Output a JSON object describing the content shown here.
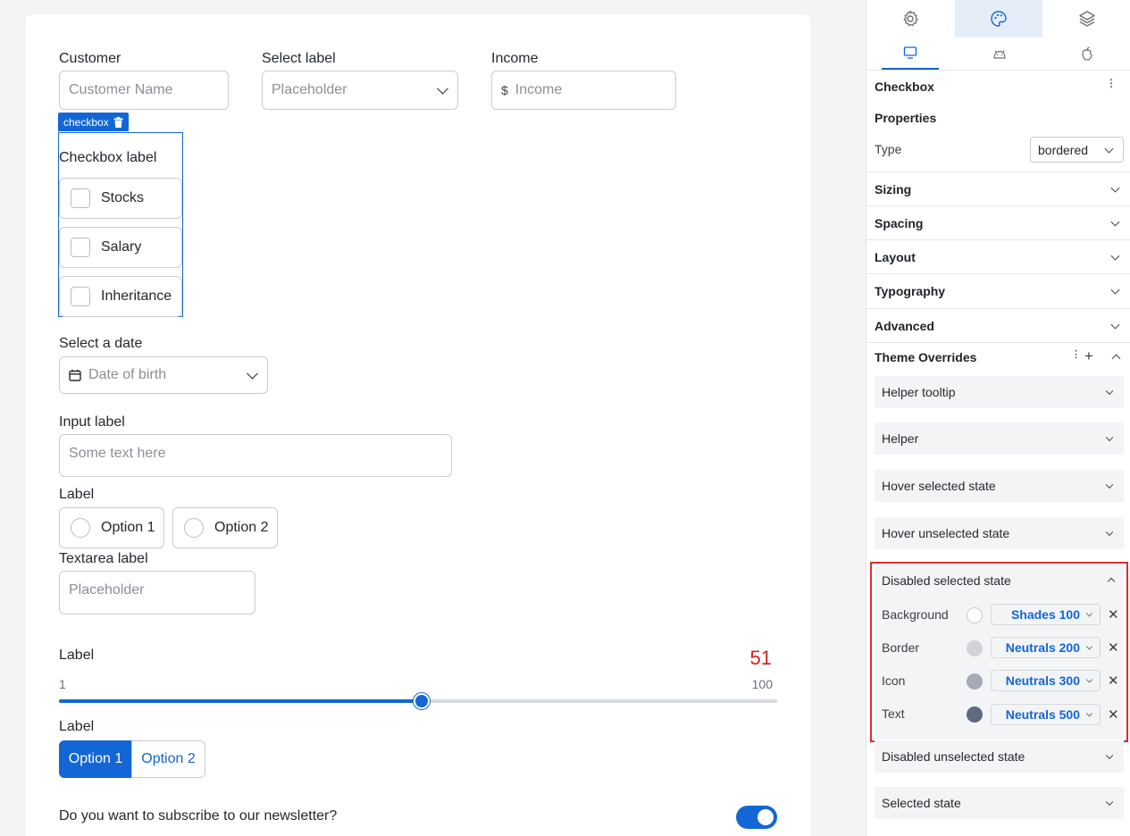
{
  "form": {
    "customer": {
      "label": "Customer",
      "placeholder": "Customer Name"
    },
    "select": {
      "label": "Select label",
      "placeholder": "Placeholder"
    },
    "income": {
      "label": "Income",
      "prefix": "$",
      "placeholder": "Income"
    },
    "checkbox_tag": "checkbox",
    "checkbox_group": {
      "label": "Checkbox label",
      "options": [
        "Stocks",
        "Salary",
        "Inheritance"
      ]
    },
    "date": {
      "label": "Select a date",
      "placeholder": "Date of birth"
    },
    "input": {
      "label": "Input label",
      "placeholder": "Some text here"
    },
    "radio": {
      "label": "Label",
      "options": [
        "Option 1",
        "Option 2"
      ]
    },
    "textarea": {
      "label": "Textarea label",
      "placeholder": "Placeholder"
    },
    "slider": {
      "label": "Label",
      "value": "51",
      "min": "1",
      "max": "100",
      "fraction": 0.505
    },
    "segmented": {
      "label": "Label",
      "options": [
        "Option 1",
        "Option 2"
      ],
      "selected_index": 0
    },
    "newsletter": {
      "label": "Do you want to subscribe to our newsletter?",
      "checked": true
    }
  },
  "panel": {
    "top_tabs": [
      "gear-icon",
      "palette-icon",
      "layers-icon"
    ],
    "active_top_tab": 1,
    "device_tabs": [
      "desktop-icon",
      "android-icon",
      "apple-icon"
    ],
    "active_device_tab": 0,
    "component_title": "Checkbox",
    "properties": {
      "title": "Properties",
      "type_label": "Type",
      "type_value": "bordered"
    },
    "sections": [
      "Sizing",
      "Spacing",
      "Layout",
      "Typography",
      "Advanced"
    ],
    "theme_overrides": {
      "title": "Theme Overrides",
      "items_before": [
        "Helper tooltip",
        "Helper",
        "Hover selected state",
        "Hover unselected state"
      ],
      "expanded": {
        "title": "Disabled selected state",
        "rows": [
          {
            "label": "Background",
            "token": "Shades 100",
            "color": "#ffffff"
          },
          {
            "label": "Border",
            "token": "Neutrals 200",
            "color": "#d0d4da"
          },
          {
            "label": "Icon",
            "token": "Neutrals 300",
            "color": "#a4abb5"
          },
          {
            "label": "Text",
            "token": "Neutrals 500",
            "color": "#5f6b7d"
          }
        ]
      },
      "items_after": [
        "Disabled unselected state",
        "Selected state"
      ]
    }
  },
  "colors": {
    "accent": "#1366d6",
    "highlight": "#e02b2b",
    "slider_value": "#d42020"
  }
}
